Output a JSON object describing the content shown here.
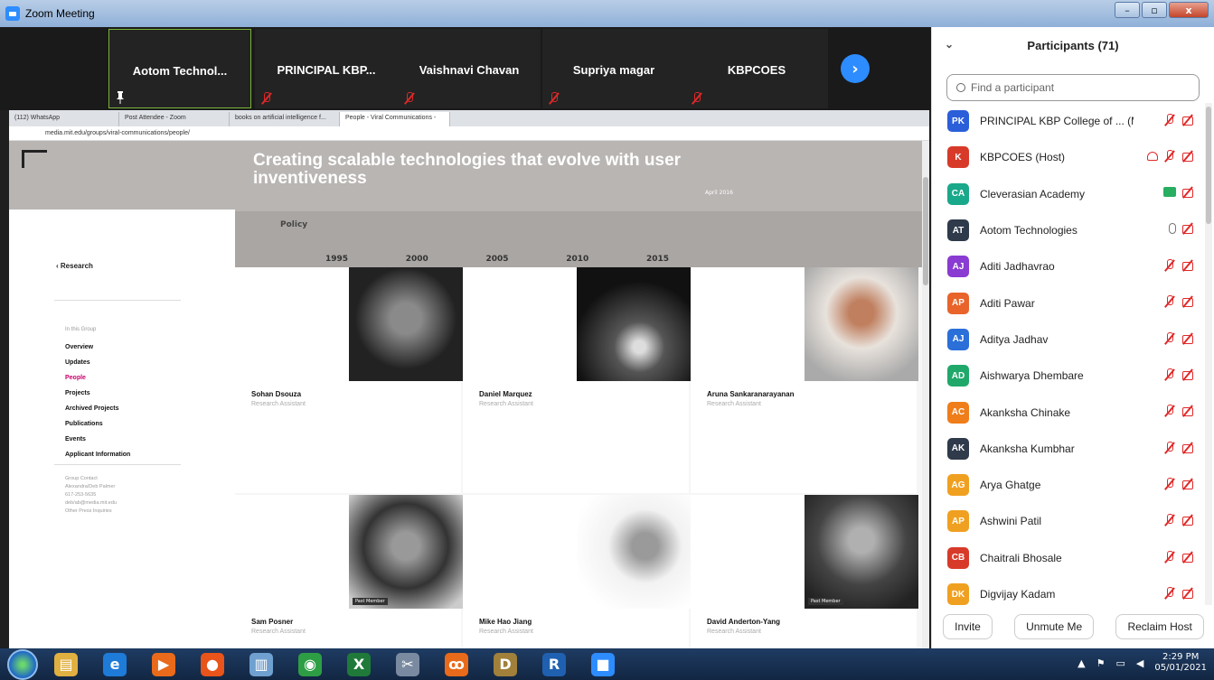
{
  "window": {
    "title": "Zoom Meeting",
    "controls": {
      "minimize": "–",
      "maximize": "▫",
      "close": "x"
    }
  },
  "gallery": {
    "tiles": [
      {
        "name": "Aotom Technol...",
        "active": true
      },
      {
        "name": "PRINCIPAL KBP..."
      },
      {
        "name": "Vaishnavi Chavan"
      },
      {
        "name": "Supriya magar"
      },
      {
        "name": "KBPCOES"
      }
    ],
    "next_glyph": "›"
  },
  "browser": {
    "tabs": [
      "(112) WhatsApp",
      "Post Attendee - Zoom",
      "books on artificial intelligence f...",
      "People - Viral Communications -"
    ],
    "url": "media.mit.edu/groups/viral-communications/people/",
    "hero_title": "Creating scalable technologies that evolve with user inventiveness",
    "hero_policy": "Policy",
    "hero_years": [
      "1995",
      "2000",
      "2005",
      "2010",
      "2015"
    ],
    "hero_date": "April 2016",
    "sidebar": {
      "back": "‹ Research",
      "group_label": "In this Group",
      "nav": [
        "Overview",
        "Updates",
        "People",
        "Projects",
        "Archived Projects",
        "Publications",
        "Events",
        "Applicant Information"
      ],
      "active_nav": "People",
      "contact": [
        "Group Contact",
        "Alexandra/Deb Palmer",
        "617-253-5635",
        "deb/ab@media.mit.edu",
        "Other Press Inquiries"
      ]
    },
    "people": [
      {
        "name": "Sohan Dsouza",
        "role": "Research Assistant"
      },
      {
        "name": "Daniel Marquez",
        "role": "Research Assistant"
      },
      {
        "name": "Aruna Sankaranarayanan",
        "role": "Research Assistant"
      },
      {
        "name": "Sam Posner",
        "role": "Research Assistant",
        "badge": "Past Member"
      },
      {
        "name": "Mike Hao Jiang",
        "role": "Research Assistant"
      },
      {
        "name": "David Anderton-Yang",
        "role": "Research Assistant",
        "badge": "Past Member"
      }
    ]
  },
  "participants": {
    "title": "Participants (71)",
    "search_placeholder": "Find a participant",
    "list": [
      {
        "initials": "PK",
        "name": "PRINCIPAL KBP College of ... (Me)",
        "color": "#2b5fd9",
        "icons": [
          "mic-off",
          "cam-off"
        ]
      },
      {
        "initials": "K",
        "name": "KBPCOES (Host)",
        "color": "#d83a2a",
        "icons": [
          "rec",
          "mic-off",
          "cam-off"
        ]
      },
      {
        "initials": "CA",
        "name": "Cleverasian Academy",
        "color": "#1aa88a",
        "icons": [
          "share",
          "cam-off"
        ]
      },
      {
        "initials": "AT",
        "name": "Aotom Technologies",
        "color": "#2f3a4a",
        "icons": [
          "mic-on",
          "cam-off"
        ]
      },
      {
        "initials": "AJ",
        "name": "Aditi Jadhavrao",
        "color": "#8a3bd1",
        "icons": [
          "mic-off",
          "cam-off"
        ]
      },
      {
        "initials": "AP",
        "name": "Aditi Pawar",
        "color": "#e8642b",
        "icons": [
          "mic-off",
          "cam-off"
        ]
      },
      {
        "initials": "AJ",
        "name": "Aditya Jadhav",
        "color": "#2b6fd9",
        "icons": [
          "mic-off",
          "cam-off"
        ]
      },
      {
        "initials": "AD",
        "name": "Aishwarya Dhembare",
        "color": "#20a86b",
        "icons": [
          "mic-off",
          "cam-off"
        ]
      },
      {
        "initials": "AC",
        "name": "Akanksha Chinake",
        "color": "#ef7d1a",
        "icons": [
          "mic-off",
          "cam-off"
        ]
      },
      {
        "initials": "AK",
        "name": "Akanksha Kumbhar",
        "color": "#2f3a4a",
        "icons": [
          "mic-off",
          "cam-off"
        ]
      },
      {
        "initials": "AG",
        "name": "Arya Ghatge",
        "color": "#f0a020",
        "icons": [
          "mic-off",
          "cam-off"
        ]
      },
      {
        "initials": "AP",
        "name": "Ashwini Patil",
        "color": "#f0a020",
        "icons": [
          "mic-off",
          "cam-off"
        ]
      },
      {
        "initials": "CB",
        "name": "Chaitrali Bhosale",
        "color": "#d83a2a",
        "icons": [
          "mic-off",
          "cam-off"
        ]
      },
      {
        "initials": "DK",
        "name": "Digvijay Kadam",
        "color": "#f0a020",
        "icons": [
          "mic-off",
          "cam-off"
        ]
      }
    ],
    "footer": {
      "invite": "Invite",
      "unmute": "Unmute Me",
      "reclaim": "Reclaim Host"
    }
  },
  "taskbar": {
    "apps": [
      {
        "icon": "file-explorer-icon",
        "glyph": "▤",
        "color": "#e0b040"
      },
      {
        "icon": "internet-explorer-icon",
        "glyph": "e",
        "color": "#1e7bd8"
      },
      {
        "icon": "media-player-icon",
        "glyph": "▶",
        "color": "#e86a1a"
      },
      {
        "icon": "firefox-icon",
        "glyph": "●",
        "color": "#e8541a"
      },
      {
        "icon": "notepad-icon",
        "glyph": "▥",
        "color": "#6fa0d0"
      },
      {
        "icon": "chrome-icon",
        "glyph": "◉",
        "color": "#2e9e45"
      },
      {
        "icon": "excel-icon",
        "glyph": "X",
        "color": "#1f7a3a"
      },
      {
        "icon": "snipping-tool-icon",
        "glyph": "✂",
        "color": "#7a8aa0"
      },
      {
        "icon": "xampp-icon",
        "glyph": "ꝏ",
        "color": "#e86a1a"
      },
      {
        "icon": "dosbox-icon",
        "glyph": "D",
        "color": "#a0803a"
      },
      {
        "icon": "r-language-icon",
        "glyph": "R",
        "color": "#2060b0"
      },
      {
        "icon": "zoom-icon",
        "glyph": "■",
        "color": "#2d8cff"
      }
    ],
    "time": "2:29 PM",
    "date": "05/01/2021"
  }
}
